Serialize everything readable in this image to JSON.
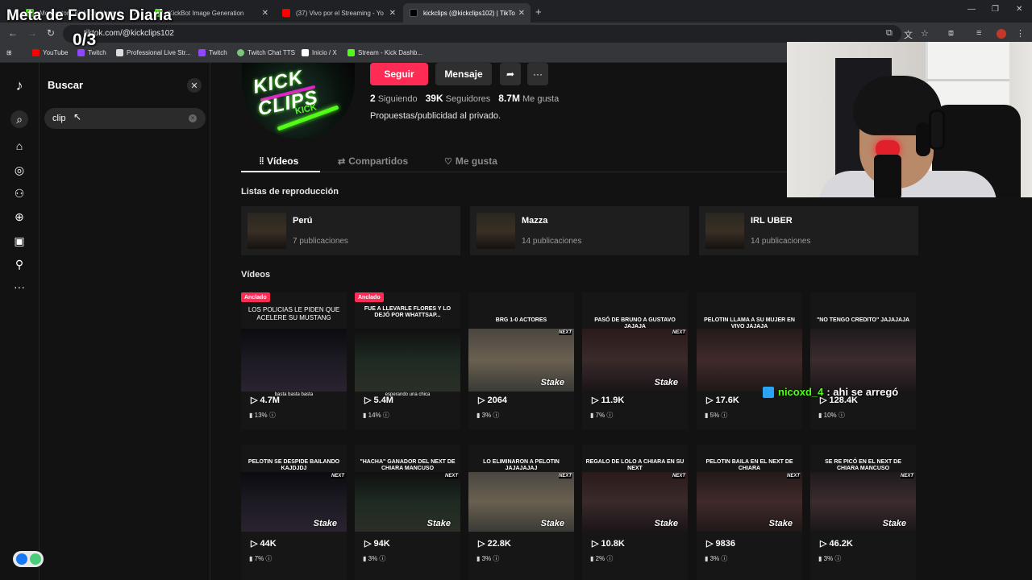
{
  "browser": {
    "tabs": [
      {
        "label": "Moderator - Kick Dashboard",
        "fav": "#53fc18"
      },
      {
        "label": "KickBot Image Generation",
        "fav": "#53fc18"
      },
      {
        "label": "(37) Vivo por el Streaming - Yo",
        "fav": "#ff0000"
      },
      {
        "label": "kickclips (@kickclips102) | TikTo",
        "fav": "#000000"
      }
    ],
    "url": "tiktok.com/@kickclips102",
    "bookmarks": [
      {
        "label": "YouTube",
        "color": "#ff0000"
      },
      {
        "label": "Twitch",
        "color": "#9146ff"
      },
      {
        "label": "Professional Live Str...",
        "color": "#ffffff"
      },
      {
        "label": "Twitch",
        "color": "#9146ff"
      },
      {
        "label": "Twitch Chat TTS",
        "color": "#7bc67b"
      },
      {
        "label": "Inicio / X",
        "color": "#ffffff"
      },
      {
        "label": "Stream - Kick Dashb...",
        "color": "#53fc18"
      }
    ]
  },
  "overlay": {
    "title": "Meta de Follows Diaria",
    "counter": "0/3"
  },
  "search": {
    "title": "Buscar",
    "value": "clip"
  },
  "profile": {
    "follow_label": "Seguir",
    "message_label": "Mensaje",
    "following_count": "2",
    "following_label": "Siguiendo",
    "followers_count": "39K",
    "followers_label": "Seguidores",
    "likes_count": "8.7M",
    "likes_label": "Me gusta",
    "bio": "Propuestas/publicidad al privado.",
    "avatar_text_1": "KICK CLIPS",
    "avatar_text_2": "KICK"
  },
  "tabs": [
    {
      "label": "Vídeos"
    },
    {
      "label": "Compartidos"
    },
    {
      "label": "Me gusta"
    }
  ],
  "playlists_heading": "Listas de reproducción",
  "playlists": [
    {
      "name": "Perú",
      "count": "7 publicaciones"
    },
    {
      "name": "Mazza",
      "count": "14 publicaciones"
    },
    {
      "name": "IRL UBER",
      "count": "14 publicaciones"
    }
  ],
  "videos_heading": "Vídeos",
  "pinned_label": "Anclado",
  "videos": [
    {
      "caption": "LOS POLICIAS LE PIDEN QUE ACELERE SU MUSTANG",
      "views": "4.7M",
      "pct": "13%",
      "pinned": true,
      "subtitle": "basta basta basta",
      "stake": false
    },
    {
      "caption": "FUE A LLEVARLE FLORES Y LO DEJÓ POR WHATTSAP...",
      "views": "5.4M",
      "pct": "14%",
      "pinned": true,
      "subtitle": "esperando una chica",
      "stake": false
    },
    {
      "caption": "BRG 1-0 ACTORES",
      "views": "2064",
      "pct": "3%",
      "pinned": false,
      "subtitle": "",
      "stake": true
    },
    {
      "caption": "PASÓ DE BRUNO A GUSTAVO JAJAJA",
      "views": "11.9K",
      "pct": "7%",
      "pinned": false,
      "subtitle": "",
      "stake": true
    },
    {
      "caption": "PELOTIN LLAMA A SU MUJER EN VIVO JAJAJA",
      "views": "17.6K",
      "pct": "5%",
      "pinned": false,
      "subtitle": "",
      "stake": false
    },
    {
      "caption": "\"NO TENGO CREDITO\" JAJAJAJA",
      "views": "128.4K",
      "pct": "10%",
      "pinned": false,
      "subtitle": "",
      "stake": false
    },
    {
      "caption": "PELOTIN SE DESPIDE BAILANDO KAJDJDJ",
      "views": "44K",
      "pct": "7%",
      "pinned": false,
      "subtitle": "",
      "stake": true
    },
    {
      "caption": "\"HACHA\" GANADOR DEL NEXT DE CHIARA MANCUSO",
      "views": "94K",
      "pct": "3%",
      "pinned": false,
      "subtitle": "",
      "stake": true
    },
    {
      "caption": "LO ELIMINARON A PELOTIN JAJAJAJAJ",
      "views": "22.8K",
      "pct": "3%",
      "pinned": false,
      "subtitle": "",
      "stake": true
    },
    {
      "caption": "REGALO DE LOLO A CHIARA EN SU NEXT",
      "views": "10.8K",
      "pct": "2%",
      "pinned": false,
      "subtitle": "",
      "stake": true
    },
    {
      "caption": "PELOTIN BAILA EN EL NEXT DE CHIARA",
      "views": "9836",
      "pct": "3%",
      "pinned": false,
      "subtitle": "",
      "stake": true
    },
    {
      "caption": "SE RE PICÓ EN EL NEXT DE CHIARA MANCUSO",
      "views": "46.2K",
      "pct": "3%",
      "pinned": false,
      "subtitle": "",
      "stake": true
    }
  ],
  "stake_text": "Stake",
  "next_text": "NEXT",
  "chat": {
    "user": "nicoxd_4",
    "message": ": ahi se arregó"
  },
  "colors": {
    "accent": "#fe2c55",
    "kick_green": "#53fc18",
    "background": "#121212"
  }
}
